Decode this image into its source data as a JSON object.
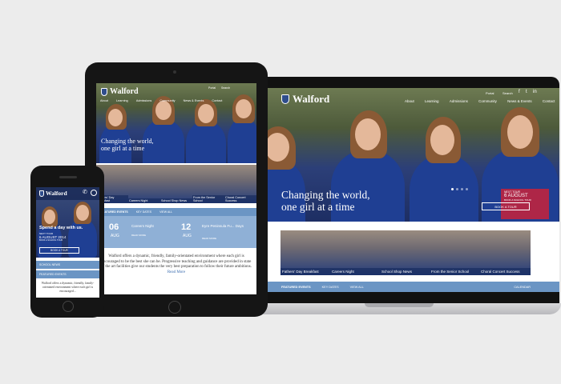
{
  "brand": {
    "name": "Walford",
    "navy": "#1f3f93",
    "accent": "#6b95c4"
  },
  "header_util": {
    "portal": "Portal",
    "search": "Search"
  },
  "nav": [
    "About",
    "Learning",
    "Admissions",
    "Community",
    "News & Events",
    "Contact"
  ],
  "hero": {
    "headline_1": "Changing the world,",
    "headline_2": "one girl at a time",
    "next_tour_label": "NEXT TOUR",
    "next_tour_date": "6 AUGUST",
    "next_tour_sub": "BOOK A SCHOOL TOUR",
    "book_button": "BOOK A TOUR"
  },
  "news_tiles": [
    "Fathers' Day Breakfast",
    "Careers Night",
    "School Shop News",
    "From the Senior School",
    "Choral Concert Success"
  ],
  "laptop_tabs": [
    "FEATURED EVENTS",
    "KEY DATES",
    "VIEW ALL"
  ],
  "laptop_tabs_right": "CALENDAR",
  "tablet_tabs": [
    "FEATURED EVENTS",
    "KEY DATES",
    "VIEW ALL"
  ],
  "tablet_events": [
    {
      "day": "06",
      "month": "AUG",
      "title": "Careers Night",
      "link": "READ MORE"
    },
    {
      "day": "12",
      "month": "AUG",
      "title": "Eyre Peninsula Fu... Days",
      "link": "READ MORE"
    }
  ],
  "tablet_body": "Walford offers a dynamic, friendly, family-orientated environment where each girl is encouraged to be the best she can be. Progressive teaching and guidance are provided in state of the art facilities give our students the very best preparation to follow their future ambitions.",
  "tablet_read_more": "Read More",
  "phone": {
    "headline": "Spend a day with us.",
    "tour_label": "NEXT TOUR",
    "tour_date": "6 AUGUST 2014",
    "tour_sub": "BOOK A SCHOOL TOUR",
    "book_button": "BOOK A TOUR",
    "section_1": "SCHOOL NEWS",
    "section_2": "FEATURED EVENTS",
    "body": "Walford offers a dynamic, friendly, family-orientated environment where each girl is encouraged..."
  }
}
